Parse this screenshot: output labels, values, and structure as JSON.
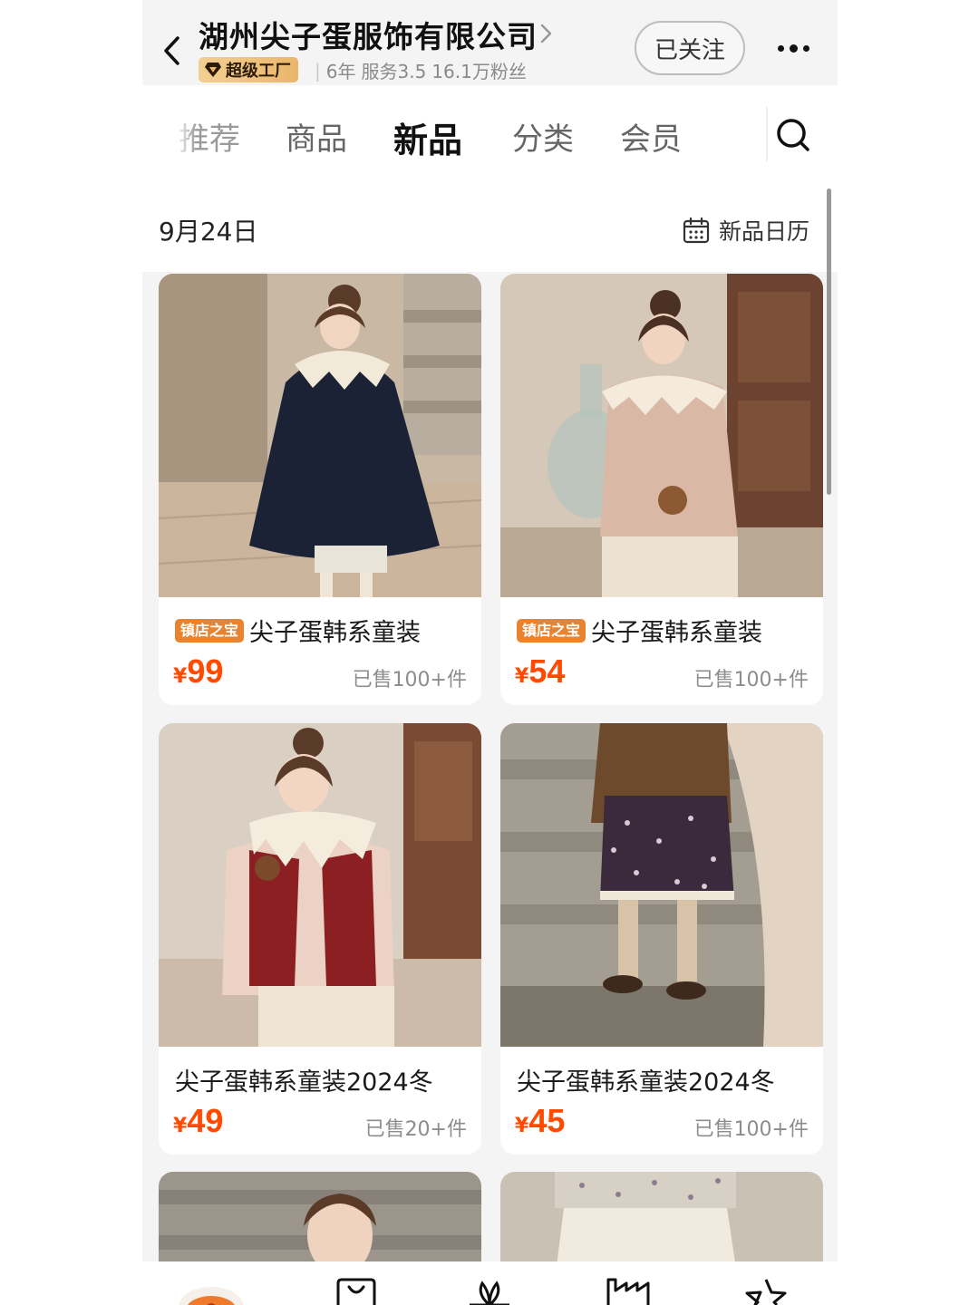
{
  "header": {
    "shop_name": "湖州尖子蛋服饰有限公司",
    "badge": "超级工厂",
    "meta": {
      "years": "6年",
      "service": "服务3.5",
      "fans": "16.1万粉丝"
    },
    "follow_label": "已关注",
    "icons": [
      "back-chevron-icon",
      "chevron-right-icon",
      "diamond-icon",
      "more-dots-icon"
    ]
  },
  "tabs": {
    "items": [
      {
        "label": "推荐",
        "active": false
      },
      {
        "label": "商品",
        "active": false
      },
      {
        "label": "新品",
        "active": true
      },
      {
        "label": "分类",
        "active": false
      },
      {
        "label": "会员",
        "active": false
      }
    ],
    "search_icon": "search-icon"
  },
  "content": {
    "date": "9月24日",
    "calendar_label": "新品日历",
    "calendar_icon": "calendar-icon"
  },
  "products": [
    {
      "tag": "镇店之宝",
      "title": "尖子蛋韩系童装",
      "price_symbol": "¥",
      "price": "99",
      "sold": "已售100+件",
      "image": "girl-black-cape-coat-photo"
    },
    {
      "tag": "镇店之宝",
      "title": "尖子蛋韩系童装",
      "price_symbol": "¥",
      "price": "54",
      "sold": "已售100+件",
      "image": "girl-pink-blouse-photo"
    },
    {
      "tag": "",
      "title": "尖子蛋韩系童装2024冬",
      "price_symbol": "¥",
      "price": "49",
      "sold": "已售20+件",
      "image": "girl-red-fleece-vest-photo"
    },
    {
      "tag": "",
      "title": "尖子蛋韩系童装2024冬",
      "price_symbol": "¥",
      "price": "45",
      "sold": "已售100+件",
      "image": "floral-skirt-on-stairs-photo"
    }
  ],
  "partial_products": [
    {
      "image": "girl-on-stairs-photo"
    },
    {
      "image": "floral-cream-skirt-photo"
    }
  ],
  "bottom_nav": {
    "icons": [
      "shop-avatar-icon",
      "shopping-bag-icon",
      "flower-icon",
      "factory-icon",
      "star-icon"
    ]
  },
  "colors": {
    "price": "#ff4a00",
    "tag_bg": "#ea8330",
    "badge_gold": "#eab66b"
  }
}
